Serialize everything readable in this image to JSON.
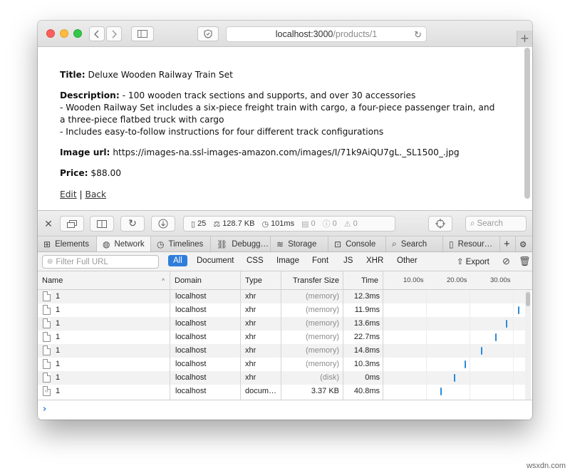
{
  "browser": {
    "url_host": "localhost:3000",
    "url_path": "/products/1",
    "new_tab_label": "+"
  },
  "page": {
    "title_label": "Title:",
    "title_value": "Deluxe Wooden Railway Train Set",
    "description_label": "Description:",
    "description_lines": [
      "- 100 wooden track sections and supports, and over 30 accessories",
      "- Wooden Railway Set includes a six-piece freight train with cargo, a four-piece passenger train, and",
      "a three-piece flatbed truck with cargo",
      "- Includes easy-to-follow instructions for four different track configurations"
    ],
    "image_url_label": "Image url:",
    "image_url_value": "https://images-na.ssl-images-amazon.com/images/I/71k9AiQU7gL._SL1500_.jpg",
    "price_label": "Price:",
    "price_value": "$88.00",
    "edit_link": "Edit",
    "separator": "|",
    "back_link": "Back"
  },
  "devtools": {
    "stats": {
      "resources": "25",
      "size": "128.7 KB",
      "time": "101ms",
      "logs": "0",
      "errors": "0",
      "warnings": "0"
    },
    "search_placeholder": "Search",
    "tabs": [
      "Elements",
      "Network",
      "Timelines",
      "Debugg…",
      "Storage",
      "Console",
      "Search",
      "Resour…"
    ],
    "active_tab": "Network",
    "filter_placeholder": "Filter Full URL",
    "filter_types": [
      "All",
      "Document",
      "CSS",
      "Image",
      "Font",
      "JS",
      "XHR",
      "Other"
    ],
    "active_filter": "All",
    "export_label": "Export",
    "columns": {
      "name": "Name",
      "domain": "Domain",
      "type": "Type",
      "transfer_size": "Transfer Size",
      "time": "Time"
    },
    "timeline_ticks": [
      "10.00s",
      "20.00s",
      "30.00s"
    ],
    "rows": [
      {
        "name": "1",
        "domain": "localhost",
        "type": "xhr",
        "size": "(memory)",
        "time": "12.3ms",
        "icon": "file-icon",
        "waterfall_fraction": 0.0
      },
      {
        "name": "1",
        "domain": "localhost",
        "type": "xhr",
        "size": "(memory)",
        "time": "11.9ms",
        "icon": "file-icon",
        "waterfall_fraction": 0.97
      },
      {
        "name": "1",
        "domain": "localhost",
        "type": "xhr",
        "size": "(memory)",
        "time": "13.6ms",
        "icon": "file-icon",
        "waterfall_fraction": 0.88
      },
      {
        "name": "1",
        "domain": "localhost",
        "type": "xhr",
        "size": "(memory)",
        "time": "22.7ms",
        "icon": "file-icon",
        "waterfall_fraction": 0.8
      },
      {
        "name": "1",
        "domain": "localhost",
        "type": "xhr",
        "size": "(memory)",
        "time": "14.8ms",
        "icon": "file-icon",
        "waterfall_fraction": 0.7
      },
      {
        "name": "1",
        "domain": "localhost",
        "type": "xhr",
        "size": "(memory)",
        "time": "10.3ms",
        "icon": "file-icon",
        "waterfall_fraction": 0.58
      },
      {
        "name": "1",
        "domain": "localhost",
        "type": "xhr",
        "size": "(disk)",
        "time": "0ms",
        "icon": "file-icon",
        "waterfall_fraction": 0.5
      },
      {
        "name": "1",
        "domain": "localhost",
        "type": "docum…",
        "size": "3.37 KB",
        "time": "40.8ms",
        "icon": "document-icon",
        "waterfall_fraction": 0.4
      }
    ],
    "console_prompt": "›"
  },
  "watermark": "wsxdn.com",
  "colors": {
    "accent": "#2f7ddb",
    "waterfall": "#2a8ad6"
  }
}
